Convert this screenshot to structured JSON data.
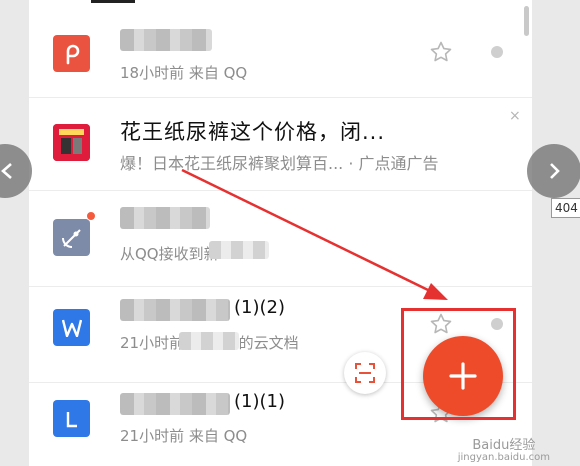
{
  "emails": [
    {
      "time_source": "18小时前   来自 QQ"
    },
    {
      "title": "花王纸尿裤这个价格，闭...",
      "subtitle": "爆！日本花王纸尿裤聚划算百... · 广点通广告",
      "close_label": "×"
    },
    {
      "subtitle": "从QQ接收到新"
    },
    {
      "title": "(1)(2)",
      "time_source": "21小时前 来自 我的云文档"
    },
    {
      "title": "(1)(1)",
      "time_source": "21小时前  来自 QQ"
    }
  ],
  "nav": {
    "page_tooltip": "404"
  },
  "watermark": {
    "main": "Baidu经验",
    "sub": "jingyan.baidu.com"
  },
  "colors": {
    "accent": "#ee4b2b",
    "annotation": "#e63131"
  }
}
